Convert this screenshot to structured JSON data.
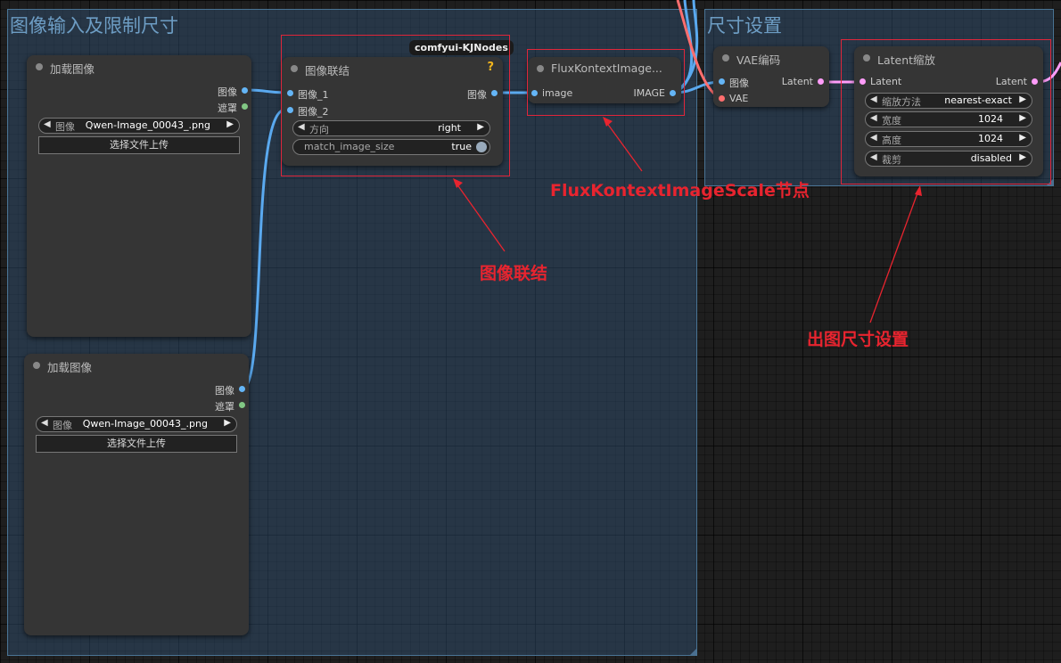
{
  "groups": {
    "left_title": "图像输入及限制尺寸",
    "right_title": "尺寸设置"
  },
  "load1": {
    "title": "加载图像",
    "out_image": "图像",
    "out_mask": "遮罩",
    "image_label": "图像",
    "image_value": "Qwen-Image_00043_.png",
    "upload": "选择文件上传"
  },
  "load2": {
    "title": "加载图像",
    "out_image": "图像",
    "out_mask": "遮罩",
    "image_label": "图像",
    "image_value": "Qwen-Image_00043_.png",
    "upload": "选择文件上传"
  },
  "concat": {
    "badge": "comfyui-KJNodes",
    "help": "?",
    "title": "图像联结",
    "in1": "图像_1",
    "in2": "图像_2",
    "out": "图像",
    "dir_label": "方向",
    "dir_value": "right",
    "match_label": "match_image_size",
    "match_value": "true"
  },
  "flux": {
    "title": "FluxKontextImage...",
    "in": "image",
    "out": "IMAGE"
  },
  "vae": {
    "title": "VAE编码",
    "in_image": "图像",
    "in_vae": "VAE",
    "out": "Latent"
  },
  "latent": {
    "title": "Latent缩放",
    "in": "Latent",
    "out": "Latent",
    "method_label": "缩放方法",
    "method_value": "nearest-exact",
    "width_label": "宽度",
    "width_value": "1024",
    "height_label": "高度",
    "height_value": "1024",
    "crop_label": "裁剪",
    "crop_value": "disabled"
  },
  "annotations": {
    "flux": "FluxKontextImageScale节点",
    "concat": "图像联结",
    "size": "出图尺寸设置"
  },
  "colors": {
    "image_pin": "#64b5f6",
    "mask_pin": "#81c784",
    "vae_pin": "#ff6e6e",
    "latent_pin": "#ff9cf9",
    "annotation_red": "#e8242f"
  }
}
